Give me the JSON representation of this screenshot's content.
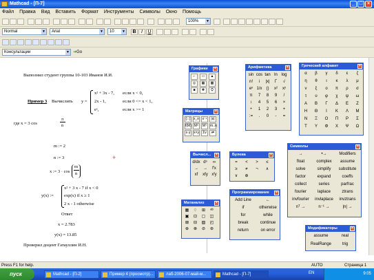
{
  "window": {
    "title": "Mathcad - [П-7]"
  },
  "menu": [
    "Файл",
    "Правка",
    "Вид",
    "Вставить",
    "Формат",
    "Инструменты",
    "Символы",
    "Окно",
    "Помощь"
  ],
  "toolbar": {
    "style_value": "Normal",
    "font_value": "Arial",
    "size_value": "10",
    "zoom_value": "100%",
    "bold": "B",
    "italic": "I",
    "underline": "U",
    "resource_value": "Консультации",
    "go_label": "Go"
  },
  "document": {
    "line1": "Выполнил студент группы 10-103    Иванов И.И.",
    "example_label": "Пример 3",
    "example_text": "Вычислить",
    "y_eq": "y =",
    "case1_expr": "x² + 3x - 7,",
    "case1_cond": "если     x < 0,",
    "case2_expr": "2x - 1,",
    "case2_cond": "если    0 <= x < 1,",
    "case3_expr": "eˣ,",
    "case3_cond": "если      x >= 1",
    "where_text": "где   x = 3 cos",
    "frac_num": "π",
    "frac_den": "n",
    "m_def": "m := 2",
    "n_def": "n := 3",
    "x_def": "x := 3 · cos",
    "x_frac_num": "m",
    "x_frac_den": "n",
    "yx_def": "y(x) :=",
    "yx_case1": "x² + 3 x - 7   if   x < 0",
    "yx_case2": "exp(x)   if   x ≥ 1",
    "yx_case3": "2 x - 1   otherwise",
    "answer_label": "Ответ",
    "x_result": "x = 2.783",
    "y_result": "y(x) = 13.85",
    "checked": "Проверил доцент Гатауллин И.Н."
  },
  "palettes": {
    "graphs": {
      "title": "Графики",
      "icons": [
        "⌐",
        "▭",
        "▲",
        "◎",
        "▦",
        "▩",
        "■",
        "✚",
        "⛭"
      ]
    },
    "arithmetic": {
      "title": "Арифметика",
      "keys": [
        "sin",
        "cos",
        "tan",
        "ln",
        "log",
        "n!",
        "i",
        "|x|",
        "Γ",
        "√",
        "eˣ",
        "1/x",
        "()",
        "x²",
        "xʸ",
        "π",
        "7",
        "8",
        "9",
        "/",
        "↕",
        "4",
        "5",
        "6",
        "×",
        "÷",
        "1",
        "2",
        "3",
        "+",
        ":=",
        ".",
        "0",
        "-",
        "="
      ]
    },
    "greek": {
      "title": "Греческий алфавит",
      "letters": [
        "α",
        "β",
        "γ",
        "δ",
        "ε",
        "ζ",
        "η",
        "θ",
        "ι",
        "κ",
        "λ",
        "μ",
        "ν",
        "ξ",
        "ο",
        "π",
        "ρ",
        "σ",
        "τ",
        "υ",
        "φ",
        "χ",
        "ψ",
        "ω",
        "Α",
        "Β",
        "Γ",
        "Δ",
        "Ε",
        "Ζ",
        "Η",
        "Θ",
        "Ι",
        "Κ",
        "Λ",
        "Μ",
        "Ν",
        "Ξ",
        "Ο",
        "Π",
        "Ρ",
        "Σ",
        "Τ",
        "Υ",
        "Φ",
        "Χ",
        "Ψ",
        "Ω"
      ]
    },
    "matrix": {
      "title": "Матрицы",
      "icons": [
        "[:::]",
        "x_n",
        "x⁻¹",
        "|x|",
        "f(M)",
        "M⁽⁾",
        "Mᵀ",
        "m..n",
        "x·y",
        "x×y",
        "Σv",
        "⇄"
      ]
    },
    "calculus": {
      "title": "Вычисл...",
      "icons": [
        "d/dx",
        "dⁿ",
        "∞",
        "∫",
        "Σ",
        "Π",
        "→",
        "→",
        "f'x",
        "xf",
        "xfy",
        "xᶠy"
      ]
    },
    "boolean": {
      "title": "Булева",
      "ops": [
        "=",
        "<",
        ">",
        "≤",
        "≥",
        "≠",
        "¬",
        "∧",
        "∨",
        "⊕"
      ]
    },
    "symbols": {
      "title": "Символы",
      "keys": [
        "→",
        "•→",
        "Modifiers",
        "float",
        "complex",
        "assume",
        "solve",
        "simplify",
        "substitute",
        "factor",
        "expand",
        "coeffs",
        "collect",
        "series",
        "parfrac",
        "fourier",
        "laplace",
        "ztrans",
        "invfourier",
        "invlaplace",
        "invztrans",
        "nᵀ →",
        "n⁻¹ →",
        "|n| →"
      ]
    },
    "programming": {
      "title": "Программирование",
      "keys": [
        "Add Line",
        "←",
        "if",
        "otherwise",
        "for",
        "while",
        "break",
        "continue",
        "return",
        "on error"
      ]
    },
    "plot2": {
      "title": "Матанализ",
      "icons": [
        "▦",
        "♢",
        "⊞",
        "ᵃᵇ",
        "▣",
        "⊡",
        "▢",
        "◫",
        "⊠",
        "⊟",
        "▨",
        "◰",
        "⊕",
        "⊗",
        "⊘",
        "⊛",
        "◉",
        "◔"
      ]
    },
    "modifiers": {
      "title": "Модификаторы",
      "keys": [
        "assume",
        "real",
        "RealRange",
        "trig"
      ]
    }
  },
  "status": {
    "help": "Press F1 for help.",
    "mode": "AUTO",
    "page": "Страница 1"
  },
  "taskbar": {
    "start": "пуск",
    "tasks": [
      "Mathcad - [П-2]",
      "Пример 4 (просмотр)...",
      "лаб-2006-07-май-м...",
      "Mathcad - [П-7]"
    ],
    "lang": "EN",
    "time": "9:05"
  },
  "colors": {
    "titlebar": "#0a4fd8",
    "palette_header": "#2c5bd8",
    "taskbar": "#245edb",
    "start": "#3fa03f"
  }
}
